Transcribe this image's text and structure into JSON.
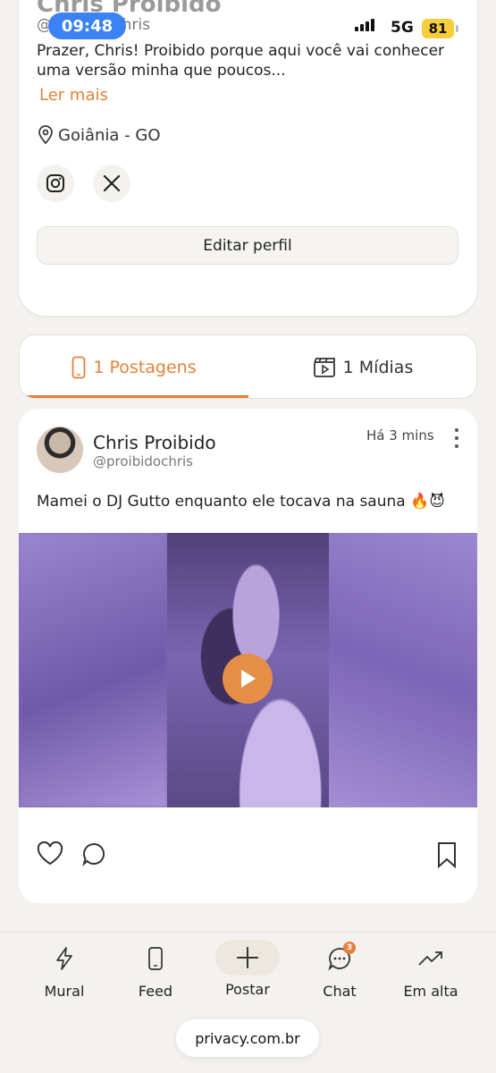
{
  "status_bar": {
    "time": "09:48",
    "network": "5G",
    "battery": "81"
  },
  "profile": {
    "name": "Chris Proibido",
    "handle": "@proibidochris",
    "bio": "Prazer, Chris! Proibido porque aqui você vai conhecer uma versão minha que poucos...",
    "read_more": "Ler mais",
    "location": "Goiânia - GO",
    "socials": [
      "instagram-icon",
      "x-icon"
    ],
    "edit_label": "Editar perfil"
  },
  "tabs": [
    {
      "label": "1 Postagens",
      "icon": "phone-icon",
      "active": true
    },
    {
      "label": "1 Mídias",
      "icon": "clapperboard-icon",
      "active": false
    }
  ],
  "post": {
    "author": "Chris Proibido",
    "handle": "@proibidochris",
    "time": "Há 3 mins",
    "caption": "Mamei o DJ Gutto enquanto ele tocava na sauna 🔥😈"
  },
  "nav": [
    {
      "label": "Mural",
      "icon": "lightning-icon"
    },
    {
      "label": "Feed",
      "icon": "phone-icon"
    },
    {
      "label": "Postar",
      "icon": "plus-icon"
    },
    {
      "label": "Chat",
      "icon": "chat-icon",
      "badge": "3"
    },
    {
      "label": "Em alta",
      "icon": "trending-icon"
    }
  ],
  "url": "privacy.com.br",
  "colors": {
    "accent": "#e3813a",
    "background": "#f4f2ee",
    "status_pill": "#3a82f5",
    "battery": "#f6cd3b"
  }
}
